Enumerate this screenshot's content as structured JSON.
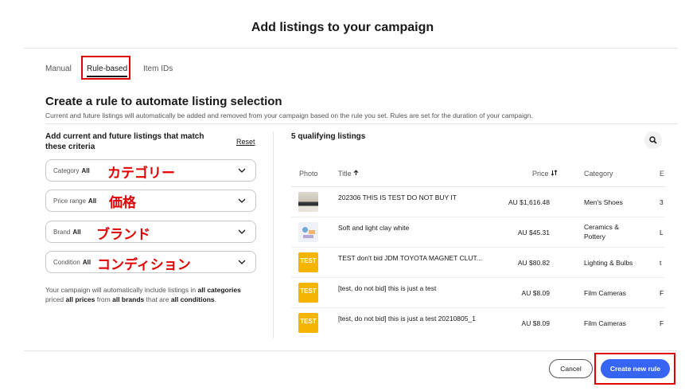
{
  "window": {
    "title": "Add listings to your campaign"
  },
  "tabs": [
    {
      "label": "Manual"
    },
    {
      "label": "Rule-based"
    },
    {
      "label": "Item IDs"
    }
  ],
  "rule": {
    "heading": "Create a rule to automate listing selection",
    "subtext": "Current and future listings will automatically be added and removed from your campaign based on the rule you set. Rules are set for the duration of your campaign.",
    "criteria_title": "Add current and future listings that match these criteria",
    "reset_label": "Reset",
    "filters": [
      {
        "label": "Category",
        "value": "All",
        "annotation": "カテゴリー"
      },
      {
        "label": "Price range",
        "value": "All",
        "annotation": "価格"
      },
      {
        "label": "Brand",
        "value": "All",
        "annotation": "ブランド"
      },
      {
        "label": "Condition",
        "value": "All",
        "annotation": "コンディション"
      }
    ],
    "summary": {
      "p1": "Your campaign will automatically include listings in ",
      "b1": "all categories",
      "p2": " priced ",
      "b2": "all prices",
      "p3": " from ",
      "b3": "all brands",
      "p4": " that are ",
      "b4": "all conditions",
      "p5": "."
    }
  },
  "results": {
    "count_label": "5 qualifying listings",
    "columns": {
      "photo": "Photo",
      "title": "Title",
      "price": "Price",
      "category": "Category",
      "extra": "E"
    },
    "rows": [
      {
        "title": "202306 THIS IS TEST DO NOT BUY IT",
        "price": "AU $1,616.48",
        "category": [
          "Men's Shoes"
        ],
        "extra": "3",
        "thumb": "shoe"
      },
      {
        "title": "Soft and light clay white",
        "price": "AU $45.31",
        "category": [
          "Ceramics &",
          "Pottery"
        ],
        "extra": "L",
        "thumb": "clay"
      },
      {
        "title": "TEST don't bid JDM TOYOTA MAGNET CLUT...",
        "price": "AU $80.82",
        "category": [
          "Lighting & Bulbs"
        ],
        "extra": "t",
        "thumb": "test"
      },
      {
        "title": "[test, do not bid] this is just a test",
        "price": "AU $8.09",
        "category": [
          "Film Cameras"
        ],
        "extra": "F",
        "thumb": "test"
      },
      {
        "title": "[test, do not bid] this is just a test 20210805_1",
        "price": "AU $8.09",
        "category": [
          "Film Cameras"
        ],
        "extra": "F",
        "thumb": "test"
      }
    ],
    "test_thumb_text": "TEST"
  },
  "footer": {
    "cancel_label": "Cancel",
    "create_label": "Create new rule"
  },
  "colors": {
    "accent": "#3665f3",
    "highlight": "#e00000",
    "test_thumb": "#f4b400"
  }
}
